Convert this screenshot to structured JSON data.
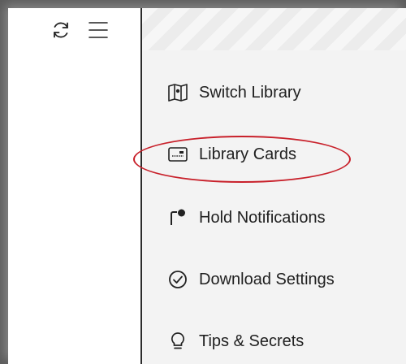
{
  "toolbar": {
    "refresh_icon": "refresh-icon",
    "menu_icon": "hamburger-menu-icon"
  },
  "menu": {
    "items": [
      {
        "label": "Switch Library",
        "icon": "map-icon"
      },
      {
        "label": "Library Cards",
        "icon": "card-icon"
      },
      {
        "label": "Hold Notifications",
        "icon": "notification-badge-icon"
      },
      {
        "label": "Download Settings",
        "icon": "check-circle-icon"
      },
      {
        "label": "Tips & Secrets",
        "icon": "lightbulb-icon"
      }
    ]
  },
  "colors": {
    "highlight": "#c8202a",
    "menu_bg": "#f3f3f3",
    "text": "#202020"
  }
}
